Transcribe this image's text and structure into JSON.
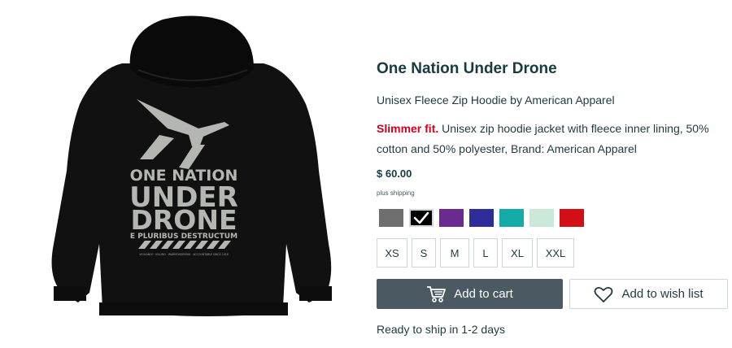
{
  "product": {
    "title": "One Nation Under Drone",
    "subtitle": "Unisex Fleece Zip Hoodie by American Apparel",
    "description_highlight": "Slimmer fit.",
    "description_text": " Unisex zip hoodie jacket with fleece inner lining, 50% cotton and 50% polyester, Brand: American Apparel",
    "price": "$ 60.00",
    "shipping_note": "plus shipping",
    "availability": "Ready to ship in 1-2 days"
  },
  "artwork": {
    "line1": "ONE NATION",
    "line2": "UNDER",
    "line3": "DRONE",
    "line4": "E PLURIBUS DESTRUCTUM",
    "fineprint": "VIGILANCE · KILLING · WARMONGERING · ACCOUNTABLE SINCE 2016"
  },
  "colors": [
    {
      "name": "gray",
      "hex": "#6e6e6e",
      "selected": false
    },
    {
      "name": "black",
      "hex": "#000000",
      "selected": true
    },
    {
      "name": "purple",
      "hex": "#6b2a8f",
      "selected": false
    },
    {
      "name": "royal-blue",
      "hex": "#2e2e9a",
      "selected": false
    },
    {
      "name": "teal",
      "hex": "#12aba8",
      "selected": false
    },
    {
      "name": "mint",
      "hex": "#cbe9d8",
      "selected": false
    },
    {
      "name": "red",
      "hex": "#d30e14",
      "selected": false
    }
  ],
  "sizes": [
    "XS",
    "S",
    "M",
    "L",
    "XL",
    "XXL"
  ],
  "buttons": {
    "add_to_cart": "Add to cart",
    "add_to_wishlist": "Add to wish list"
  },
  "icons": {
    "cart": "cart-icon",
    "wishlist": "heart-icon",
    "check": "check-icon"
  }
}
